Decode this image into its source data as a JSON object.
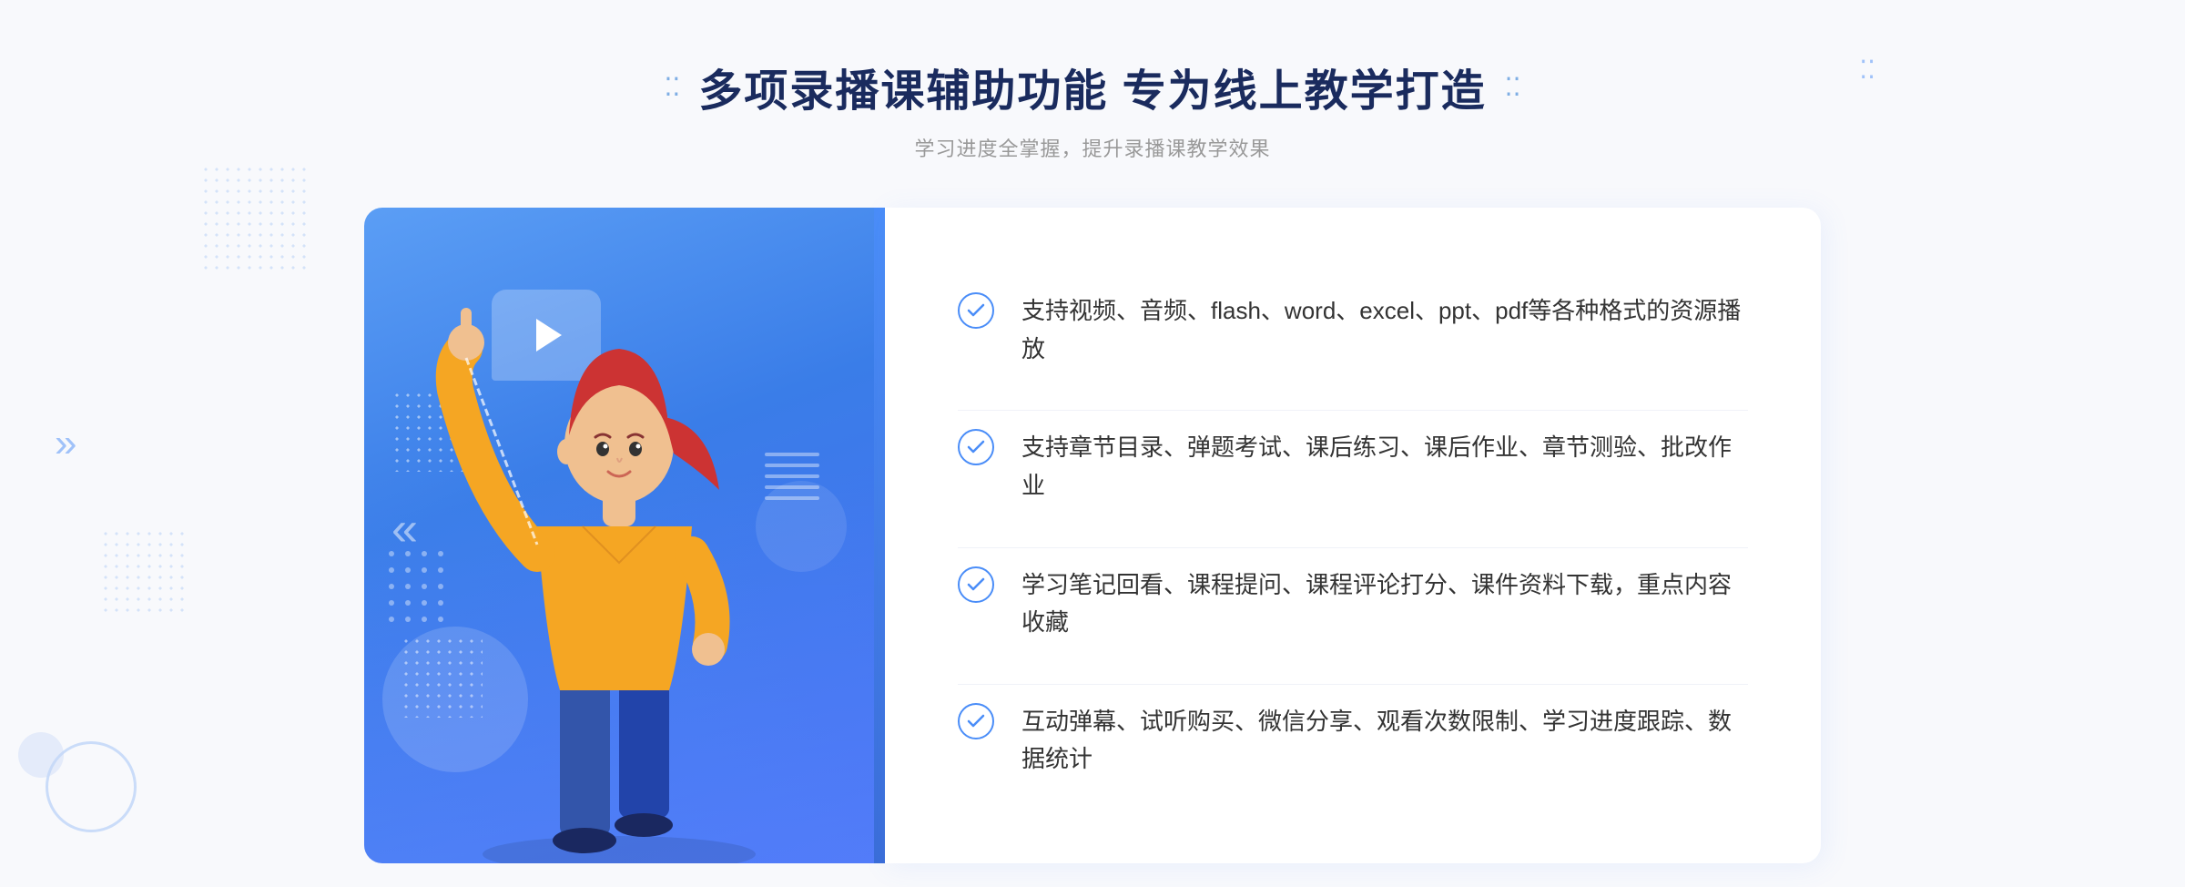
{
  "header": {
    "title": "多项录播课辅助功能 专为线上教学打造",
    "subtitle": "学习进度全掌握，提升录播课教学效果",
    "dots_icon": "⁚"
  },
  "features": [
    {
      "id": 1,
      "text": "支持视频、音频、flash、word、excel、ppt、pdf等各种格式的资源播放"
    },
    {
      "id": 2,
      "text": "支持章节目录、弹题考试、课后练习、课后作业、章节测验、批改作业"
    },
    {
      "id": 3,
      "text": "学习笔记回看、课程提问、课程评论打分、课件资料下载，重点内容收藏"
    },
    {
      "id": 4,
      "text": "互动弹幕、试听购买、微信分享、观看次数限制、学习进度跟踪、数据统计"
    }
  ],
  "colors": {
    "primary_blue": "#4a8df8",
    "dark_blue": "#1a2b5e",
    "gradient_start": "#5b9ef5",
    "gradient_end": "#4a6cf7",
    "text_dark": "#333333",
    "text_gray": "#999999"
  }
}
